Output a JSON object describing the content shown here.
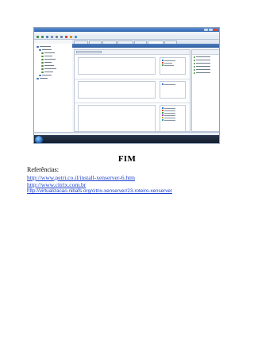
{
  "screenshot": {
    "alt": "XenCenter window screenshot"
  },
  "document": {
    "heading": "FIM",
    "references_title": "Referências:",
    "references": [
      "http://www.petri.co.il/install-xenserver-6.htm",
      "http://www.citrix.com.br",
      "http://virtualizacao.nibafs.org/citrix-xenserver/23-roteiro-xenserver"
    ]
  }
}
